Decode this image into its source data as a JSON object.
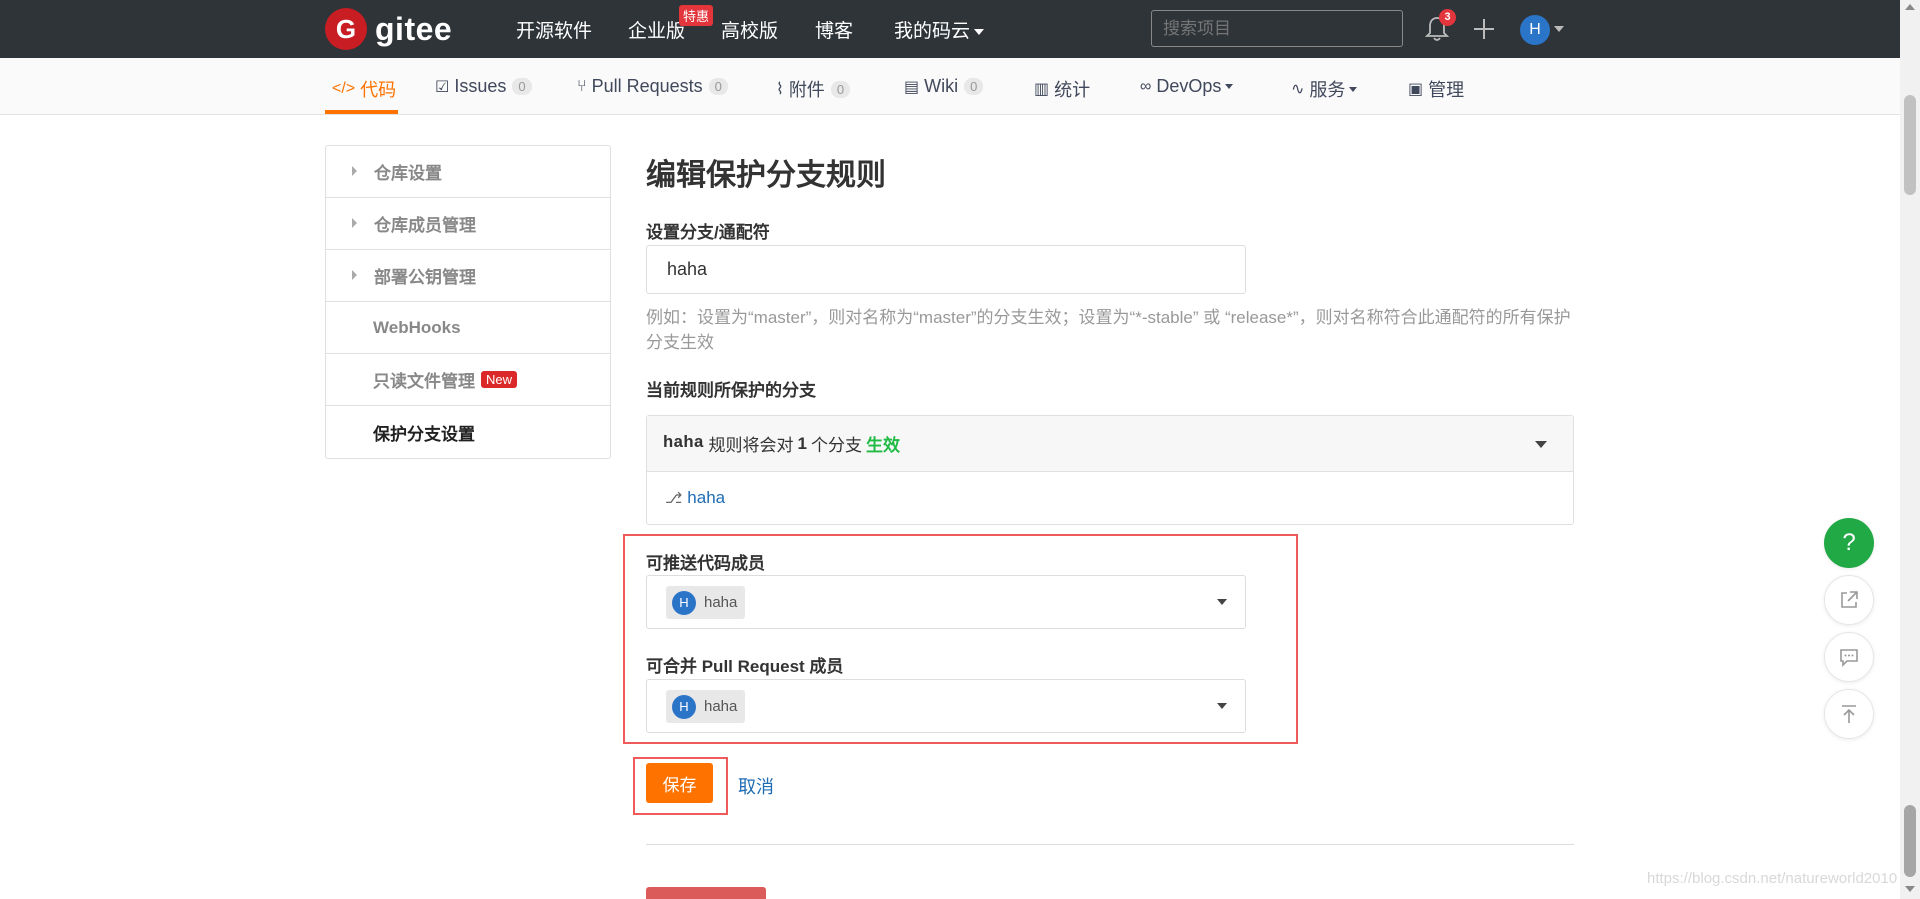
{
  "brand": {
    "name": "gitee",
    "badge_letter": "G",
    "color": "#c71d23"
  },
  "topnav": {
    "links": [
      "开源软件",
      "企业版",
      "高校版",
      "博客",
      "我的码云"
    ],
    "hot_badge": "特惠",
    "search_placeholder": "搜索项目",
    "notification_count": "3",
    "user_initial": "H"
  },
  "tabs": [
    {
      "label": "代码",
      "icon": "code-icon",
      "active": true
    },
    {
      "label": "Issues",
      "icon": "issues-icon",
      "count": "0"
    },
    {
      "label": "Pull Requests",
      "icon": "pull-request-icon",
      "count": "0"
    },
    {
      "label": "附件",
      "icon": "attachment-icon",
      "count": "0"
    },
    {
      "label": "Wiki",
      "icon": "wiki-icon",
      "count": "0"
    },
    {
      "label": "统计",
      "icon": "stats-icon"
    },
    {
      "label": "DevOps",
      "icon": "devops-icon"
    },
    {
      "label": "服务",
      "icon": "service-icon"
    },
    {
      "label": "管理",
      "icon": "manage-icon"
    }
  ],
  "sidebar": {
    "items": [
      {
        "label": "仓库设置"
      },
      {
        "label": "仓库成员管理"
      },
      {
        "label": "部署公钥管理"
      },
      {
        "label": "WebHooks"
      },
      {
        "label": "只读文件管理",
        "badge": "New"
      },
      {
        "label": "保护分支设置"
      }
    ]
  },
  "main": {
    "title": "编辑保护分支规则",
    "branch_field": {
      "label": "设置分支/通配符",
      "value": "haha",
      "hint": "例如：设置为“master”，则对名称为“master”的分支生效；设置为“*-stable” 或 “release*”，则对名称符合此通配符的所有保护分支生效"
    },
    "protected": {
      "label": "当前规则所保护的分支",
      "rule_name": "haha",
      "text_a": "规则将会对",
      "count": "1",
      "text_b": "个分支",
      "status": "生效",
      "branch": "haha"
    },
    "push_members": {
      "label": "可推送代码成员",
      "chip_initial": "H",
      "chip_name": "haha"
    },
    "merge_members": {
      "label": "可合并 Pull Request 成员",
      "chip_initial": "H",
      "chip_name": "haha"
    },
    "save_label": "保存",
    "cancel_label": "取消"
  },
  "float": {
    "help": "?"
  },
  "watermark": "https://blog.csdn.net/natureworld2010",
  "colors": {
    "accent": "#fe7300",
    "link": "#1e6cb4",
    "success": "#21ba45",
    "danger": "#db2828"
  }
}
